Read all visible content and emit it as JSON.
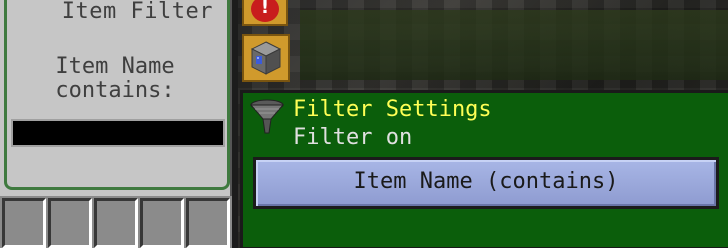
{
  "item_filter": {
    "title": "Item Filter",
    "label": "Item Name\ncontains:",
    "input_value": ""
  },
  "side_tabs": {
    "alert_icon": "warning-icon",
    "alert_symbol": "!",
    "filter_icon": "filter-cube-icon"
  },
  "filter_settings": {
    "title": "Filter Settings",
    "status": "Filter on",
    "mode_button_label": "Item Name (contains)",
    "icon": "funnel-icon"
  },
  "colors": {
    "panel_green": "#0b5e0b",
    "title_yellow": "#ffff55",
    "button_blue": "#a8b6e6",
    "tab_orange": "#d09a2c",
    "alert_red": "#c81d1d"
  },
  "inventory": {
    "visible_slots": 5
  }
}
